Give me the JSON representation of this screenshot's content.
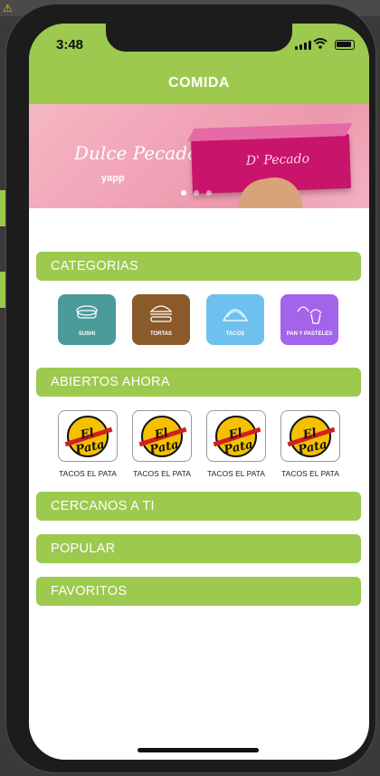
{
  "status": {
    "time": "3:48"
  },
  "header": {
    "title": "COMIDA"
  },
  "banner": {
    "brand": "Dulce Pecado",
    "brand_box": "D' Pecado",
    "powered": "yapp"
  },
  "sections": {
    "categories": "CATEGORIAS",
    "open_now": "ABIERTOS AHORA",
    "nearby": "CERCANOS A TI",
    "popular": "POPULAR",
    "favorites": "FAVORITOS"
  },
  "categories": [
    {
      "label": "SUSHI",
      "color": "#4b9b9b",
      "icon": "sushi-icon"
    },
    {
      "label": "TORTAS",
      "color": "#8b5a2b",
      "icon": "burger-icon"
    },
    {
      "label": "TACOS",
      "color": "#6ec1ef",
      "icon": "taco-icon"
    },
    {
      "label": "PAN Y PASTELES",
      "color": "#a363ea",
      "icon": "cupcake-icon"
    }
  ],
  "open_shops": [
    {
      "name": "TACOS EL PATA",
      "logo": "El Pata"
    },
    {
      "name": "TACOS EL PATA",
      "logo": "El Pata"
    },
    {
      "name": "TACOS EL PATA",
      "logo": "El Pata"
    },
    {
      "name": "TACOS EL PATA",
      "logo": "El Pata"
    }
  ],
  "colors": {
    "accent": "#9dc94f"
  }
}
